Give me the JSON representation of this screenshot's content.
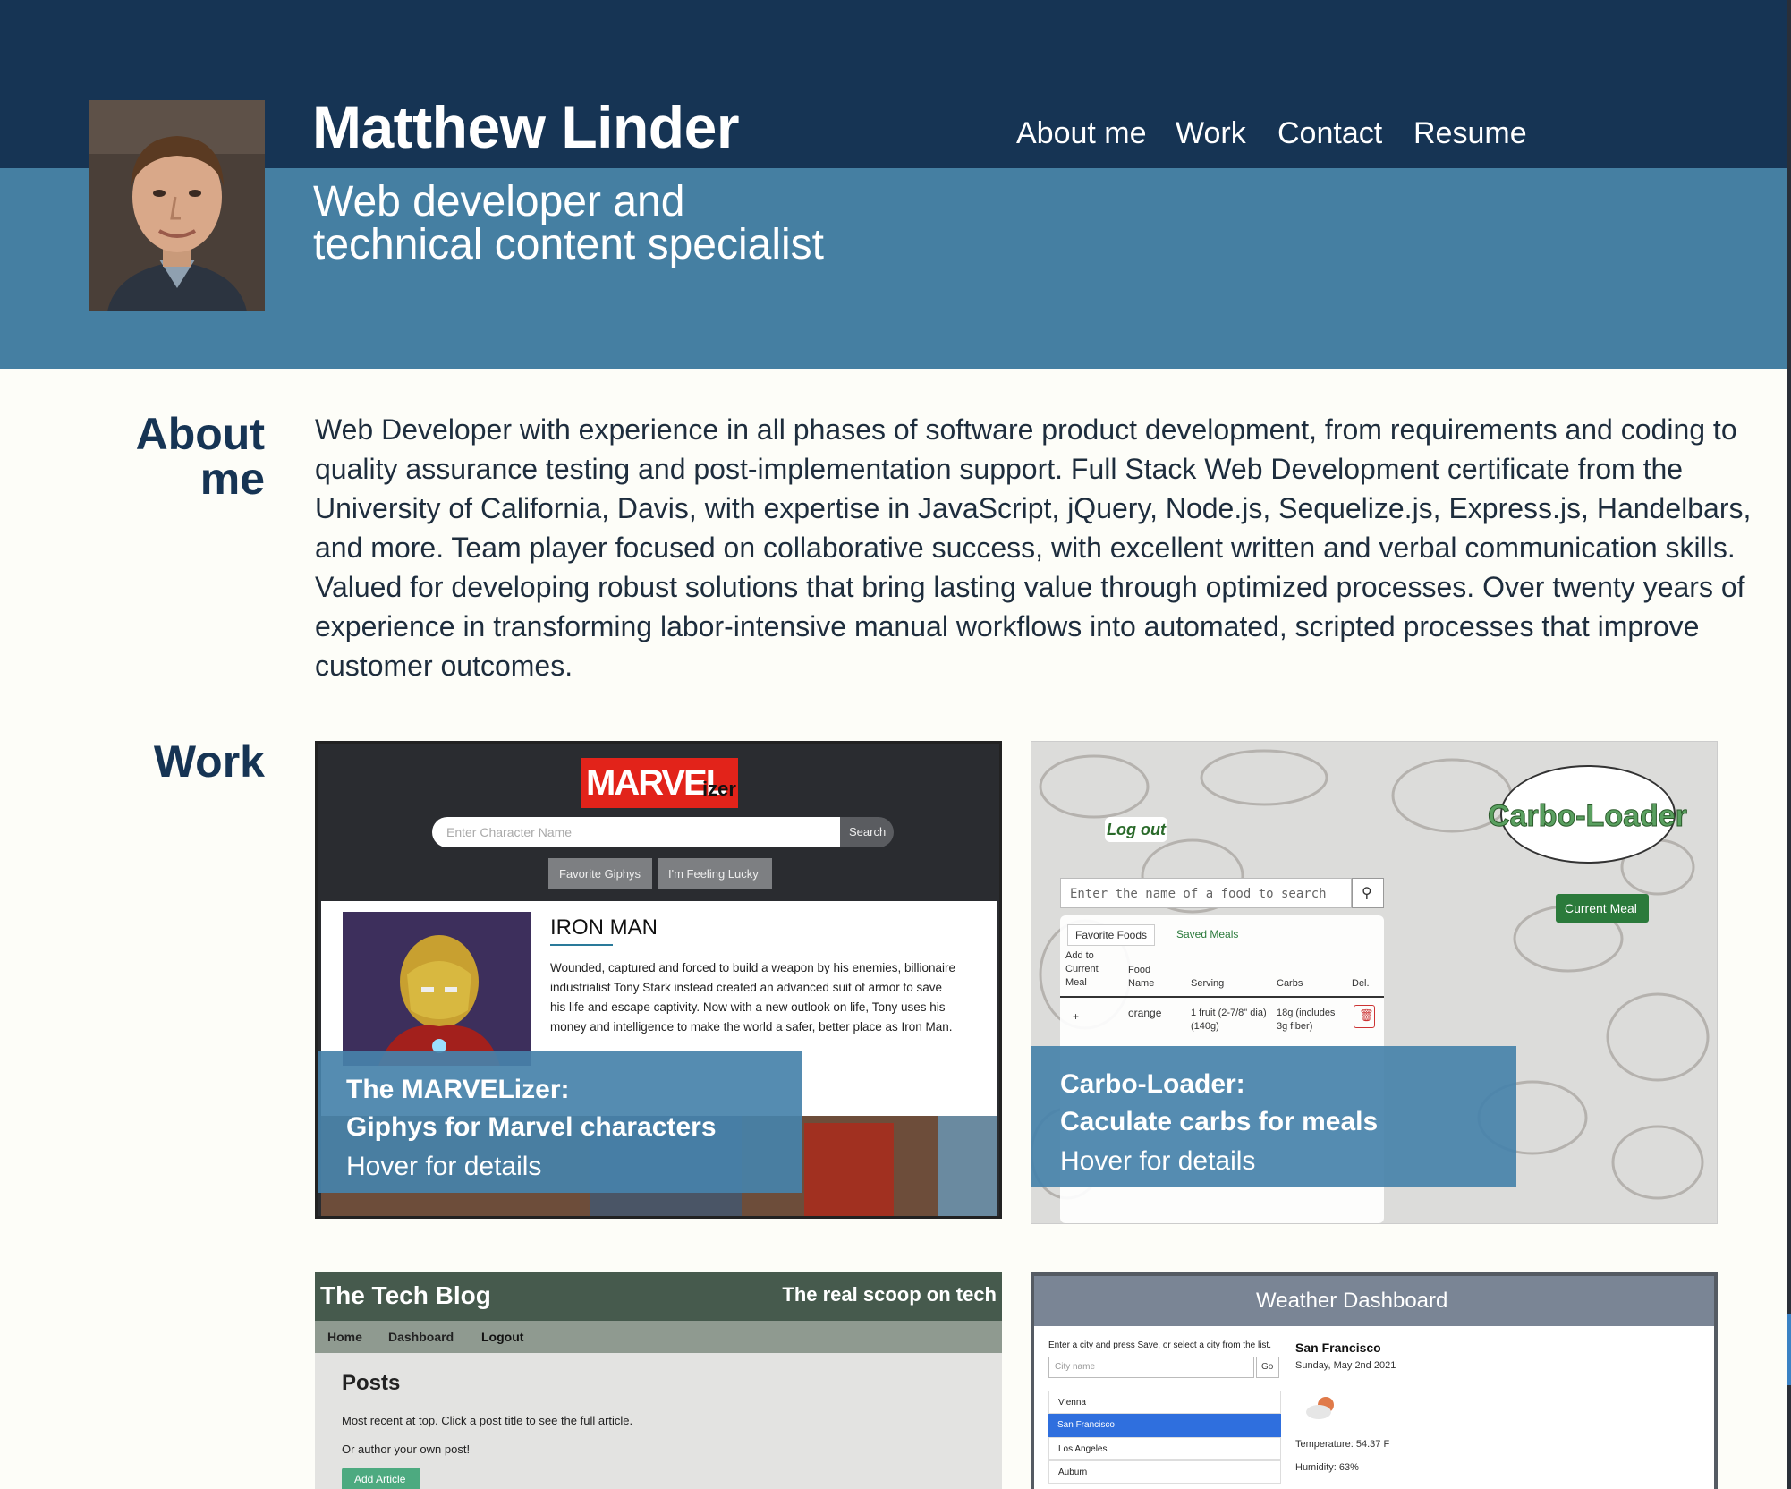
{
  "header": {
    "name": "Matthew Linder",
    "tagline_line1": "Web developer and",
    "tagline_line2": "technical content specialist",
    "nav": [
      "About me",
      "Work",
      "Contact",
      "Resume"
    ]
  },
  "about": {
    "heading_line1": "About",
    "heading_line2": "me",
    "text": "Web Developer with experience in all phases of software product development, from requirements and coding to quality assurance testing and post-implementation support. Full Stack Web Development certificate from the University of California, Davis, with expertise in JavaScript, jQuery, Node.js, Sequelize.js, Express.js, Handelbars, and more. Team player focused on collaborative success, with excellent written and verbal communication skills. Valued for developing robust solutions that bring lasting value through optimized processes. Over twenty years of experience in transforming labor-intensive manual workflows into automated, scripted processes that improve customer outcomes."
  },
  "work": {
    "heading": "Work",
    "projects": [
      {
        "title_line1": "The MARVELizer:",
        "title_line2": "Giphys for Marvel characters",
        "hover": "Hover for details",
        "shot": {
          "logo": "MARVEL",
          "logo_suffix": "izer",
          "search_placeholder": "Enter Character Name",
          "search_button": "Search",
          "button1": "Favorite Giphys",
          "button2": "I'm Feeling Lucky",
          "hero": "IRON MAN",
          "description": "Wounded, captured and forced to build a weapon by his enemies, billionaire industrialist Tony Stark instead created an advanced suit of armor to save his life and escape captivity. Now with a new outlook on life, Tony uses his money and intelligence to make the world a safer, better place as Iron Man."
        }
      },
      {
        "title_line1": "Carbo-Loader:",
        "title_line2": "Caculate carbs for meals",
        "hover": "Hover for details",
        "shot": {
          "logo": "Carbo-Loader",
          "logout": "Log out",
          "search_placeholder": "Enter the name of a food to search",
          "current_meal": "Current Meal",
          "tab1": "Favorite Foods",
          "tab2": "Saved Meals",
          "col_add": "Add to Current Meal",
          "col_food": "Food Name",
          "col_serving": "Serving",
          "col_carbs": "Carbs",
          "col_del": "Del.",
          "row_add": "+",
          "row_food": "orange",
          "row_serving": "1 fruit (2-7/8\" dia) (140g)",
          "row_carbs": "18g (includes 3g fiber)"
        }
      },
      {
        "shot": {
          "title": "The Tech Blog",
          "tagline": "The real scoop on tech",
          "nav": [
            "Home",
            "Dashboard",
            "Logout"
          ],
          "heading": "Posts",
          "line1": "Most recent at top. Click a post title to see the full article.",
          "line2": "Or author your own post!",
          "button": "Add Article"
        }
      },
      {
        "shot": {
          "title": "Weather Dashboard",
          "instructions": "Enter a city and press Save, or select a city from the list.",
          "city_placeholder": "City name",
          "go": "Go",
          "cities": [
            "Vienna",
            "San Francisco",
            "Los Angeles",
            "Auburn"
          ],
          "city": "San Francisco",
          "date": "Sunday, May 2nd 2021",
          "temperature": "Temperature: 54.37 F",
          "humidity": "Humidity: 63%"
        }
      }
    ]
  }
}
